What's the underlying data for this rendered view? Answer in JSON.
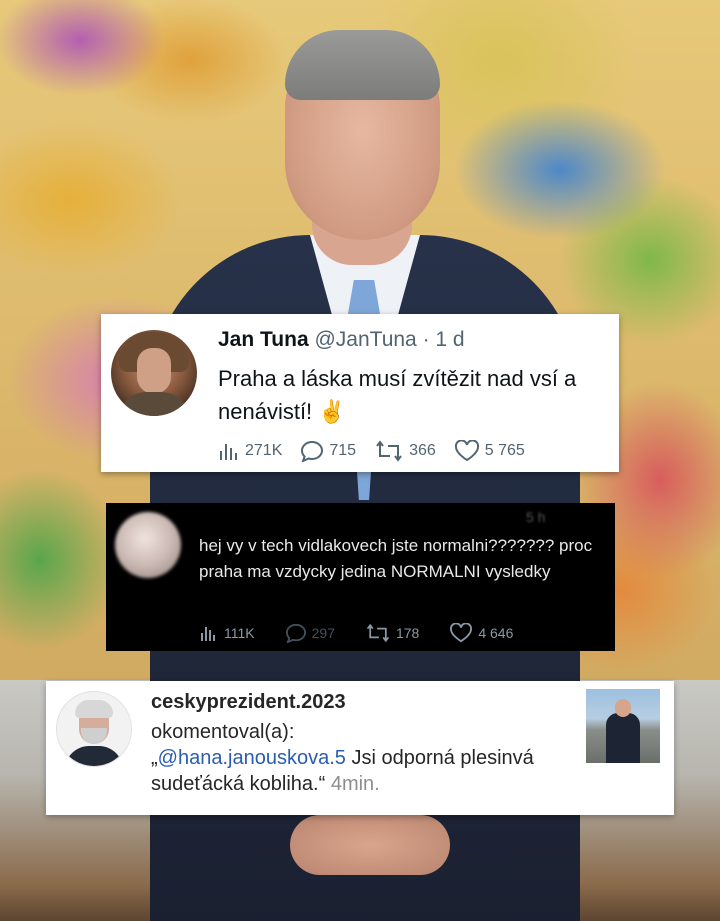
{
  "tweet": {
    "name": "Jan Tuna",
    "handle": "@JanTuna",
    "separator": "·",
    "time": "1 d",
    "text": "Praha a láska musí zvítězit nad vsí a nenávistí! ✌️",
    "views": "271K",
    "replies": "715",
    "retweets": "366",
    "likes": "5 765"
  },
  "reply": {
    "time": "5 h",
    "text": "hej vy v tech vidlakovech jste normalni??????? proc praha ma vzdycky jedina NORMALNI vysledky",
    "views": "111K",
    "replies": "297",
    "retweets": "178",
    "likes": "4 646"
  },
  "comment": {
    "username": "ceskyprezident.2023",
    "action": "okomentoval(a):",
    "quote_open": "„",
    "mention": "@hana.janouskova.5",
    "text": " Jsi odporná plesinvá sudeťácká kobliha.“ ",
    "time": "4min."
  },
  "colors": {
    "tweet_bg": "#ffffff",
    "reply_bg": "#000000",
    "mention": "#2a5db0"
  },
  "icons": [
    "views-icon",
    "reply-icon",
    "retweet-icon",
    "like-icon"
  ]
}
